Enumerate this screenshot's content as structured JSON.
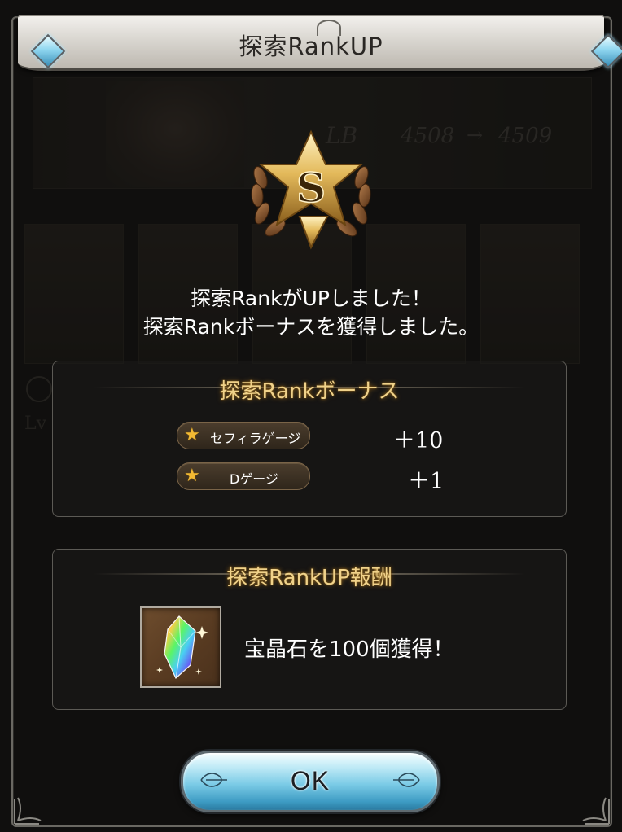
{
  "background": {
    "lb_label": "LB",
    "value_from": "4508",
    "arrow": "→",
    "value_to": "4509",
    "level_label": "Lv"
  },
  "dialog": {
    "title": "探索RankUP",
    "badge_letter": "S",
    "message_line1": "探索RankがUPしました！",
    "message_line2": "探索Rankボーナスを獲得しました。",
    "bonus": {
      "heading": "探索Rankボーナス",
      "items": [
        {
          "icon": "star-icon",
          "label": "セフィラゲージ",
          "value": "＋10"
        },
        {
          "icon": "star-icon",
          "label": "Dゲージ",
          "value": "＋1"
        }
      ]
    },
    "reward": {
      "heading": "探索RankUP報酬",
      "item_icon": "rainbow-crystal-icon",
      "text": "宝晶石を100個獲得！"
    },
    "ok_label": "OK"
  },
  "colors": {
    "heading_gold": "#f0d28a",
    "star_gold": "#f2b933",
    "button_blue": "#7bcbe6"
  }
}
